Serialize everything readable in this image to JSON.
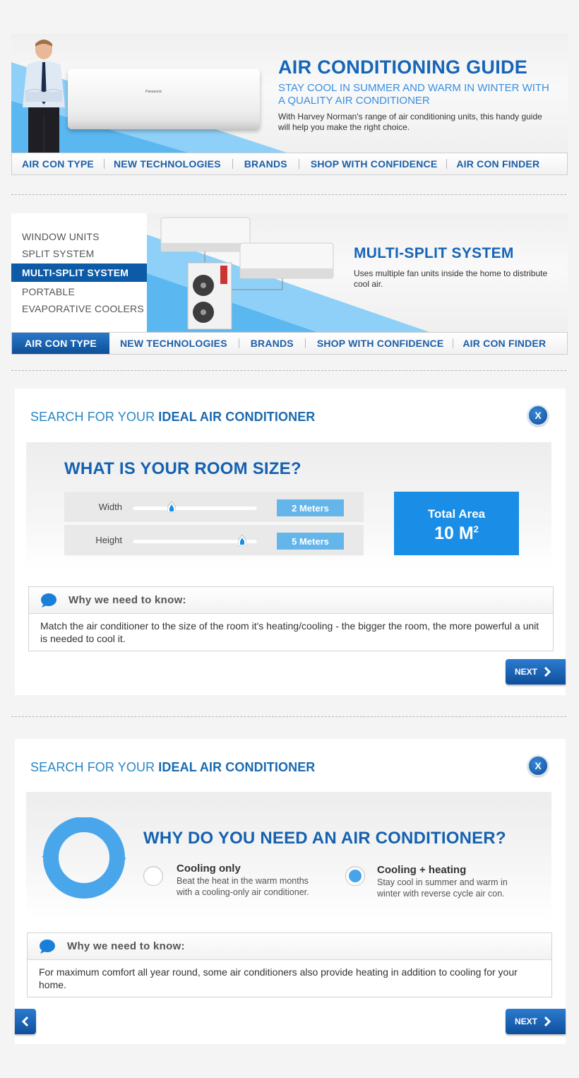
{
  "banner1": {
    "title": "AIR CONDITIONING GUIDE",
    "subtitle": "STAY COOL IN SUMMER AND WARM IN WINTER WITH A QUALITY AIR CONDITIONER",
    "text": "With Harvey Norman's range of air conditioning units, this handy guide will help you make the right choice.",
    "product_brand": "Panasonic"
  },
  "nav1": [
    "AIR CON TYPE",
    "NEW TECHNOLOGIES",
    "BRANDS",
    "SHOP WITH CONFIDENCE",
    "AIR CON FINDER"
  ],
  "panel2": {
    "menu": [
      "WINDOW UNITS",
      "SPLIT SYSTEM",
      "MULTI-SPLIT SYSTEM",
      "PORTABLE",
      "EVAPORATIVE COOLERS"
    ],
    "active_index": 2,
    "title": "MULTI-SPLIT SYSTEM",
    "text": "Uses multiple fan units inside the home to distribute cool air."
  },
  "nav2": {
    "items": [
      "AIR CON TYPE",
      "NEW TECHNOLOGIES",
      "BRANDS",
      "SHOP WITH CONFIDENCE",
      "AIR CON FINDER"
    ],
    "active": "AIR CON TYPE"
  },
  "search1": {
    "title_prefix": "SEARCH FOR YOUR ",
    "title_bold": "IDEAL AIR CONDITIONER",
    "close_label": "X",
    "question": "WHAT IS YOUR ROOM SIZE?",
    "width_label": "Width",
    "width_value": "2 Meters",
    "width_level": 0.31,
    "height_label": "Height",
    "height_value": "5 Meters",
    "height_level": 0.88,
    "total_label": "Total Area",
    "total_value": "10 M",
    "total_unit_sup": "2",
    "why_title": "Why we need to know:",
    "why_text": "Match the air conditioner to the size of the room it's heating/cooling - the bigger the room, the more powerful a unit is needed to cool it.",
    "next_label": "NEXT"
  },
  "search2": {
    "title_prefix": "SEARCH FOR YOUR ",
    "title_bold": "IDEAL AIR CONDITIONER",
    "close_label": "X",
    "question": "WHY DO YOU NEED AN AIR CONDITIONER?",
    "option1_title": "Cooling only",
    "option1_desc": "Beat the heat in the warm months with a cooling-only air conditioner.",
    "option2_title": "Cooling + heating",
    "option2_desc": "Stay cool in summer and warm in winter with reverse cycle air con.",
    "selected_option": 2,
    "why_title": "Why we need to know:",
    "why_text": "For maximum comfort all year round, some air conditioners also provide heating in addition to cooling for your home.",
    "next_label": "NEXT"
  },
  "colors": {
    "brand_blue": "#1565b8",
    "accent_blue": "#1a8de6",
    "light_blue": "#63b5ea"
  }
}
